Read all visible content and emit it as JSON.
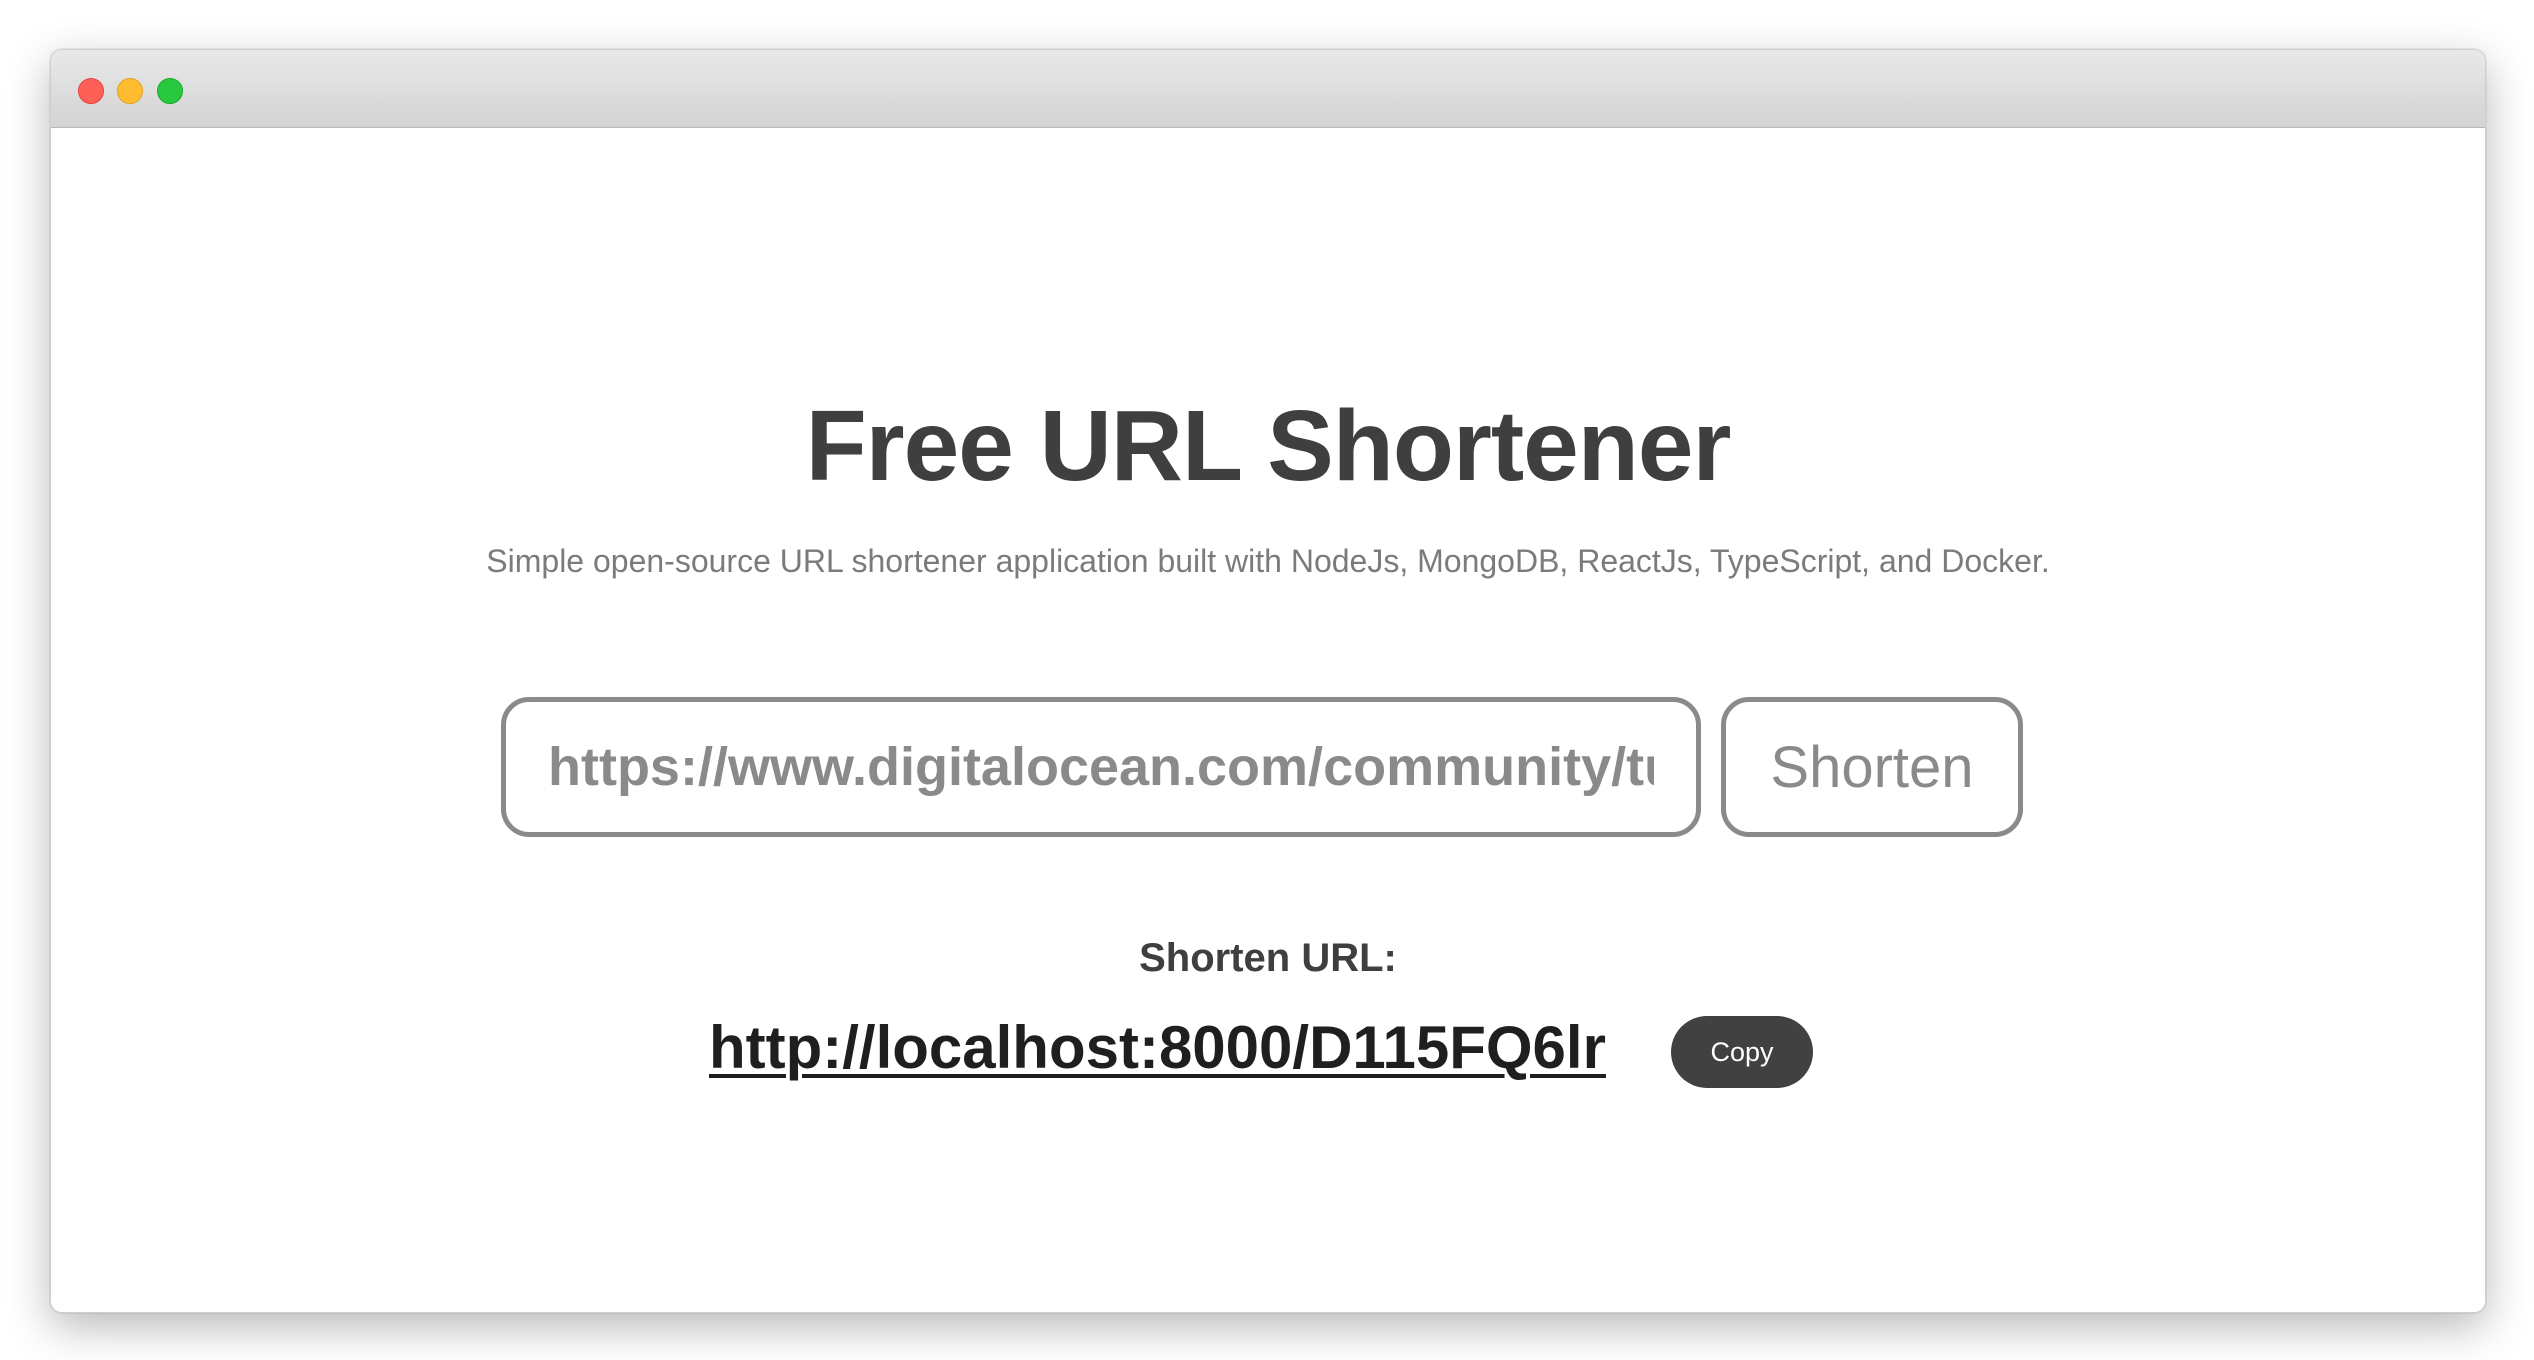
{
  "window": {
    "controls": [
      "close",
      "minimize",
      "zoom"
    ]
  },
  "page": {
    "title": "Free URL Shortener",
    "subtitle": "Simple open-source URL shortener application built with NodeJs, MongoDB, ReactJs, TypeScript, and Docker."
  },
  "form": {
    "url_value": "https://www.digitalocean.com/community/tut",
    "shorten_label": "Shorten"
  },
  "result": {
    "label": "Shorten URL:",
    "short_url": "http://localhost:8000/D115FQ6lr",
    "copy_label": "Copy"
  },
  "colors": {
    "title_text": "#3f3f3f",
    "subtitle_text": "#7b7b7b",
    "input_border": "#8a8a8a",
    "copy_button_bg": "#414141"
  }
}
